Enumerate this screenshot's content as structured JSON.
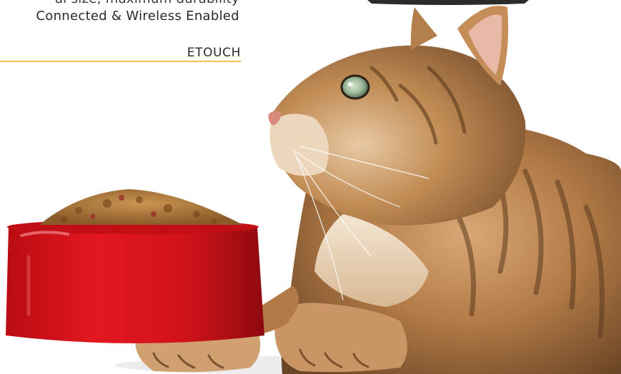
{
  "copy": {
    "partial_line": "al size, maximum durability",
    "main_line": "Connected & Wireless Enabled",
    "brand": "ETOUCH"
  },
  "colors": {
    "accent_rule": "#f1c04a",
    "bowl_red": "#d4121a",
    "cat_fur": "#b47c48",
    "text": "#2a2a2a"
  }
}
